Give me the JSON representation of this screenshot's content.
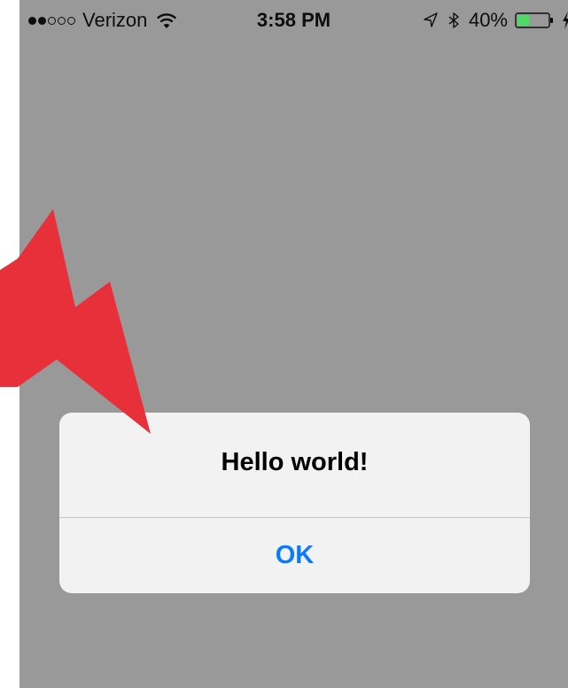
{
  "status_bar": {
    "carrier": "Verizon",
    "signal_bars_filled": 2,
    "signal_bars_total": 5,
    "time": "3:58 PM",
    "battery_percent": "40%",
    "battery_level": 0.4,
    "icons": [
      "wifi-icon",
      "location-icon",
      "bluetooth-icon",
      "battery-icon",
      "charging-bolt-icon"
    ]
  },
  "alert": {
    "title": "Hello world!",
    "button_label": "OK"
  },
  "colors": {
    "background": "#999999",
    "alert_bg": "#f2f2f2",
    "button_text": "#0a7aff",
    "arrow": "#e8303a",
    "battery_fill": "#4cd964"
  }
}
